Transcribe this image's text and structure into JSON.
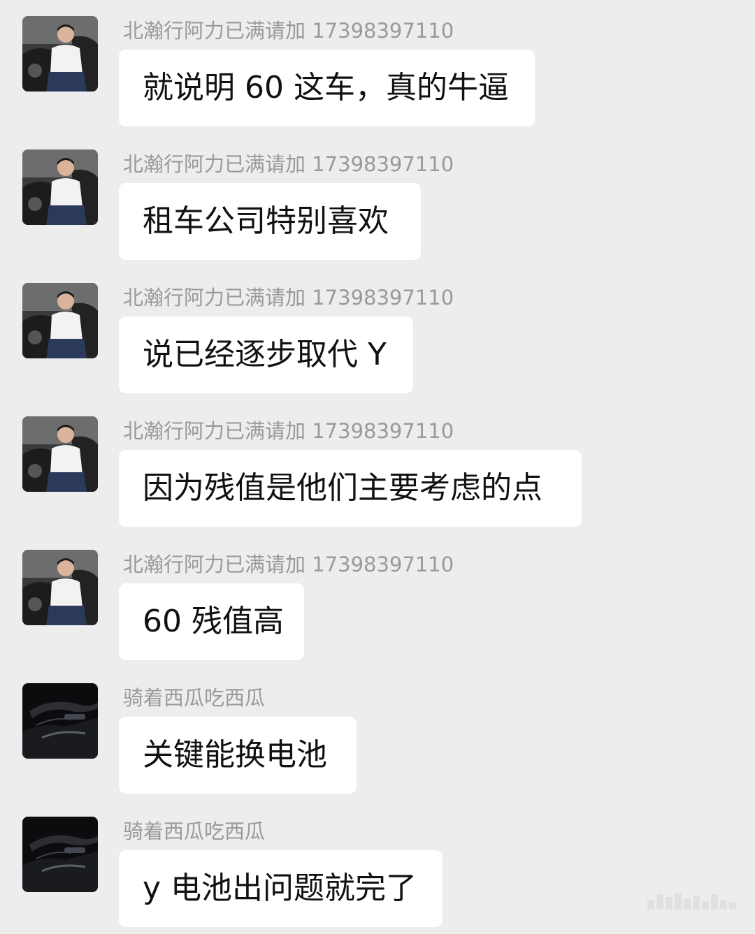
{
  "chat": {
    "messages": [
      {
        "sender": "北瀚行阿力已满请加 17398397110",
        "text": "就说明 60 这车，真的牛逼",
        "avatar": "man-car-avatar"
      },
      {
        "sender": "北瀚行阿力已满请加 17398397110",
        "text": "租车公司特别喜欢",
        "avatar": "man-car-avatar"
      },
      {
        "sender": "北瀚行阿力已满请加 17398397110",
        "text": "说已经逐步取代 Y",
        "avatar": "man-car-avatar"
      },
      {
        "sender": "北瀚行阿力已满请加 17398397110",
        "text": "因为残值是他们主要考虑的点",
        "avatar": "man-car-avatar"
      },
      {
        "sender": "北瀚行阿力已满请加 17398397110",
        "text": "60 残值高",
        "avatar": "man-car-avatar"
      },
      {
        "sender": "骑着西瓜吃西瓜",
        "text": "关键能换电池",
        "avatar": "car-interior-avatar"
      },
      {
        "sender": "骑着西瓜吃西瓜",
        "text": "y 电池出问题就完了",
        "avatar": "car-interior-avatar"
      }
    ]
  },
  "colors": {
    "background": "#ededed",
    "bubble": "#ffffff",
    "sender_text": "#9a9a9a",
    "message_text": "#111111"
  }
}
